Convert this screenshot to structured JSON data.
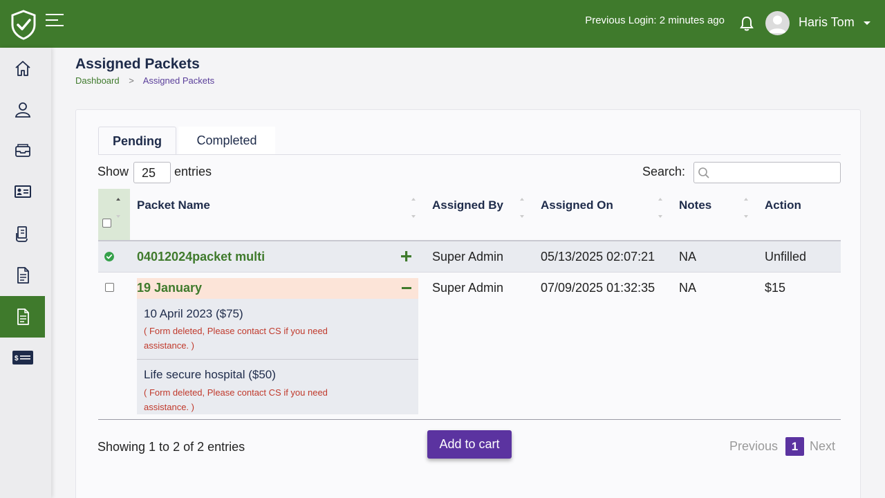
{
  "header": {
    "previous_login": "Previous Login: 2 minutes ago",
    "user_name": "Haris Tom",
    "brand_color": "#3f7a2c"
  },
  "sidebar": {
    "items": [
      {
        "icon": "home-icon",
        "active": false
      },
      {
        "icon": "user-icon",
        "active": false
      },
      {
        "icon": "inbox-icon",
        "active": false
      },
      {
        "icon": "id-card-icon",
        "active": false
      },
      {
        "icon": "documents-hand-icon",
        "active": false
      },
      {
        "icon": "document-icon",
        "active": false
      },
      {
        "icon": "document-icon",
        "active": true
      },
      {
        "icon": "billing-icon",
        "active": false
      }
    ]
  },
  "page": {
    "title": "Assigned Packets",
    "breadcrumb": {
      "home": "Dashboard",
      "separator": ">",
      "current": "Assigned Packets"
    }
  },
  "tabs": [
    {
      "label": "Pending",
      "active": true
    },
    {
      "label": "Completed",
      "active": false
    }
  ],
  "table_controls": {
    "show_label": "Show",
    "page_size": "25",
    "entries_label": "entries",
    "search_label": "Search:",
    "search_value": ""
  },
  "table": {
    "columns": [
      "Packet Name",
      "Assigned By",
      "Assigned On",
      "Notes",
      "Action"
    ],
    "rows": [
      {
        "name": "04012024packet multi",
        "assigned_by": "Super Admin",
        "assigned_on": "05/13/2025 02:07:21",
        "notes": "NA",
        "action": "Unfilled",
        "status": "completed-check",
        "expanded": false
      },
      {
        "name": "19 January",
        "assigned_by": "Super Admin",
        "assigned_on": "07/09/2025 01:32:35",
        "notes": "NA",
        "action": "$15",
        "expanded": true,
        "items": [
          {
            "title": "10 April 2023 ($75)",
            "error": "( Form deleted, Please contact CS if you need assistance. )"
          },
          {
            "title": "Life secure hospital ($50)",
            "error": "( Form deleted, Please contact CS if you need assistance. )"
          }
        ]
      }
    ]
  },
  "footer": {
    "info": "Showing 1 to 2 of 2 entries",
    "add_to_cart": "Add to cart",
    "previous": "Previous",
    "current_page": "1",
    "next": "Next",
    "accent_color": "#5b33a0"
  }
}
